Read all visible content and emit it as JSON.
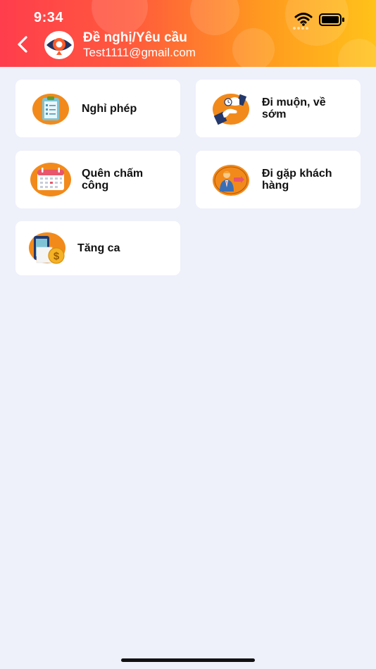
{
  "status_bar": {
    "time": "9:34"
  },
  "header": {
    "title": "Đề nghị/Yêu cầu",
    "subtitle": "Test1111@gmail.com",
    "back_icon": "chevron-left-icon",
    "logo_icon": "eye-logo-icon"
  },
  "requests": [
    {
      "label_line1": "Nghỉ phép",
      "label_line2": "",
      "icon": "clipboard-checklist-icon"
    },
    {
      "label_line1": "Đi muộn, về",
      "label_line2": "sớm",
      "icon": "hand-clock-icon"
    },
    {
      "label_line1": "Quên chấm",
      "label_line2": "công",
      "icon": "calendar-icon"
    },
    {
      "label_line1": "Đi gặp khách",
      "label_line2": "hàng",
      "icon": "businessman-icon"
    },
    {
      "label_line1": "Tăng ca",
      "label_line2": "",
      "icon": "phone-dollar-icon"
    }
  ],
  "colors": {
    "header_start": "#ff3d4d",
    "header_end": "#ffc21a",
    "icon_orange": "#f28a1b",
    "background": "#eef0fa"
  }
}
